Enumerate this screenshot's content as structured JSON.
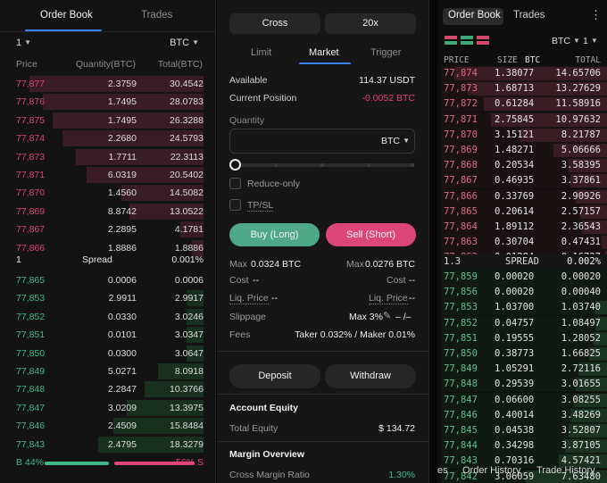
{
  "left_book": {
    "tabs": [
      "Order Book",
      "Trades"
    ],
    "grouping": "1",
    "unit": "BTC",
    "headers": {
      "price": "Price",
      "quantity": "Quantity(BTC)",
      "total": "Total(BTC)"
    },
    "asks": [
      {
        "price": "77,877",
        "qty": "2.3759",
        "total": "30.4542",
        "fill": 0.91
      },
      {
        "price": "77,876",
        "qty": "1.7495",
        "total": "28.0783",
        "fill": 0.84
      },
      {
        "price": "77,875",
        "qty": "1.7495",
        "total": "26.3288",
        "fill": 0.79
      },
      {
        "price": "77,874",
        "qty": "2.2680",
        "total": "24.5793",
        "fill": 0.74
      },
      {
        "price": "77,873",
        "qty": "1.7711",
        "total": "22.3113",
        "fill": 0.67
      },
      {
        "price": "77,871",
        "qty": "6.0319",
        "total": "20.5402",
        "fill": 0.61
      },
      {
        "price": "77,870",
        "qty": "1.4560",
        "total": "14.5082",
        "fill": 0.43
      },
      {
        "price": "77,869",
        "qty": "8.8742",
        "total": "13.0522",
        "fill": 0.39
      },
      {
        "price": "77,867",
        "qty": "2.2895",
        "total": "4.1781",
        "fill": 0.12
      },
      {
        "price": "77,866",
        "qty": "1.8886",
        "total": "1.8886",
        "fill": 0.06
      }
    ],
    "spread": {
      "value": "1",
      "label": "Spread",
      "pct": "0.001%"
    },
    "bids": [
      {
        "price": "77,865",
        "qty": "0.0006",
        "total": "0.0006",
        "fill": 0.0
      },
      {
        "price": "77,853",
        "qty": "2.9911",
        "total": "2.9917",
        "fill": 0.09
      },
      {
        "price": "77,852",
        "qty": "0.0330",
        "total": "3.0246",
        "fill": 0.09
      },
      {
        "price": "77,851",
        "qty": "0.0101",
        "total": "3.0347",
        "fill": 0.09
      },
      {
        "price": "77,850",
        "qty": "0.0300",
        "total": "3.0647",
        "fill": 0.09
      },
      {
        "price": "77,849",
        "qty": "5.0271",
        "total": "8.0918",
        "fill": 0.24
      },
      {
        "price": "77,848",
        "qty": "2.2847",
        "total": "10.3766",
        "fill": 0.31
      },
      {
        "price": "77,847",
        "qty": "3.0209",
        "total": "13.3975",
        "fill": 0.4
      },
      {
        "price": "77,846",
        "qty": "2.4509",
        "total": "15.8484",
        "fill": 0.47
      },
      {
        "price": "77,843",
        "qty": "2.4795",
        "total": "18.3279",
        "fill": 0.55
      }
    ],
    "buy_pct_label": "B 44%",
    "sell_pct_label": "56% S",
    "buy_fraction": 0.44
  },
  "order_form": {
    "margin_mode": "Cross",
    "leverage": "20x",
    "tabs": [
      "Limit",
      "Market",
      "Trigger"
    ],
    "available_label": "Available",
    "available_value": "114.37 USDT",
    "position_label": "Current Position",
    "position_value": "-0.0052 BTC",
    "quantity_label": "Quantity",
    "quantity_unit": "BTC",
    "slider_fraction": 0.0,
    "reduce_only_label": "Reduce-only",
    "tpsl_label": "TP/SL",
    "buy_button": "Buy (Long)",
    "sell_button": "Sell (Short)",
    "max_label": "Max",
    "max_long": "0.0324 BTC",
    "max_short": "0.0276 BTC",
    "cost_label": "Cost",
    "cost_long": "--",
    "cost_short": "--",
    "liq_label": "Liq. Price",
    "liq_long": "--",
    "liq_short": "--",
    "slippage_label": "Slippage",
    "slippage_value": "Max 3%",
    "slippage_extra": "– /–",
    "fees_label": "Fees",
    "fees_value": "Taker 0.032% / Maker 0.01%",
    "deposit_button": "Deposit",
    "withdraw_button": "Withdraw",
    "account_equity_title": "Account Equity",
    "total_equity_label": "Total Equity",
    "total_equity_value": "$ 134.72",
    "margin_overview_title": "Margin Overview",
    "cross_margin_label": "Cross Margin Ratio",
    "cross_margin_value": "1.30%"
  },
  "right_book": {
    "tabs": [
      "Order Book",
      "Trades"
    ],
    "unit": "BTC",
    "grouping": "1",
    "headers": {
      "price": "PRICE",
      "size": "SIZE",
      "size_unit": "BTC",
      "total": "TOTAL"
    },
    "asks": [
      {
        "price": "77,874",
        "size": "1.38077",
        "total": "14.65706",
        "fill": 0.92
      },
      {
        "price": "77,873",
        "size": "1.68713",
        "total": "13.27629",
        "fill": 0.84
      },
      {
        "price": "77,872",
        "size": "0.61284",
        "total": "11.58916",
        "fill": 0.74
      },
      {
        "price": "77,871",
        "size": "2.75845",
        "total": "10.97632",
        "fill": 0.7
      },
      {
        "price": "77,870",
        "size": "3.15121",
        "total": "8.21787",
        "fill": 0.52
      },
      {
        "price": "77,869",
        "size": "1.48271",
        "total": "5.06666",
        "fill": 0.32
      },
      {
        "price": "77,868",
        "size": "0.20534",
        "total": "3.58395",
        "fill": 0.23
      },
      {
        "price": "77,867",
        "size": "0.46935",
        "total": "3.37861",
        "fill": 0.22
      },
      {
        "price": "77,866",
        "size": "0.33769",
        "total": "2.90926",
        "fill": 0.19
      },
      {
        "price": "77,865",
        "size": "0.20614",
        "total": "2.57157",
        "fill": 0.16
      },
      {
        "price": "77,864",
        "size": "1.89112",
        "total": "2.36543",
        "fill": 0.15
      },
      {
        "price": "77,863",
        "size": "0.30704",
        "total": "0.47431",
        "fill": 0.03
      },
      {
        "price": "77,862",
        "size": "0.01284",
        "total": "0.16727",
        "fill": 0.01
      },
      {
        "price": "77,861",
        "size": "0.15443",
        "total": "0.15443",
        "fill": 0.01
      }
    ],
    "spread": {
      "value": "1.3",
      "label": "SPREAD",
      "pct": "0.002%"
    },
    "bids": [
      {
        "price": "77,859",
        "size": "0.00020",
        "total": "0.00020",
        "fill": 0.0
      },
      {
        "price": "77,856",
        "size": "0.00020",
        "total": "0.00040",
        "fill": 0.0
      },
      {
        "price": "77,853",
        "size": "1.03700",
        "total": "1.03740",
        "fill": 0.07
      },
      {
        "price": "77,852",
        "size": "0.04757",
        "total": "1.08497",
        "fill": 0.07
      },
      {
        "price": "77,851",
        "size": "0.19555",
        "total": "1.28052",
        "fill": 0.08
      },
      {
        "price": "77,850",
        "size": "0.38773",
        "total": "1.66825",
        "fill": 0.11
      },
      {
        "price": "77,849",
        "size": "1.05291",
        "total": "2.72116",
        "fill": 0.17
      },
      {
        "price": "77,848",
        "size": "0.29539",
        "total": "3.01655",
        "fill": 0.19
      },
      {
        "price": "77,847",
        "size": "0.06600",
        "total": "3.08255",
        "fill": 0.2
      },
      {
        "price": "77,846",
        "size": "0.40014",
        "total": "3.48269",
        "fill": 0.22
      },
      {
        "price": "77,845",
        "size": "0.04538",
        "total": "3.52807",
        "fill": 0.23
      },
      {
        "price": "77,844",
        "size": "0.34298",
        "total": "3.87105",
        "fill": 0.25
      },
      {
        "price": "77,843",
        "size": "0.70316",
        "total": "4.57421",
        "fill": 0.29
      },
      {
        "price": "77,842",
        "size": "3.06059",
        "total": "7.63480",
        "fill": 0.49
      }
    ],
    "bottom_tabs": [
      "es",
      "Order History",
      "Trade History"
    ]
  },
  "colors": {
    "buy": "#3fb98a",
    "sell": "#e0457b",
    "accent": "#3b82f6"
  },
  "icons": [
    "chevron-down-icon",
    "kebab-menu-icon",
    "layout-both-icon",
    "layout-bids-icon",
    "layout-asks-icon",
    "edit-pencil-icon"
  ]
}
